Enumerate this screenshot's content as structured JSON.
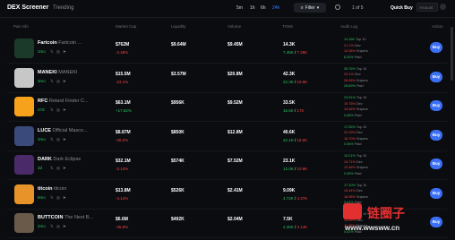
{
  "topbar": {
    "brand": "DEX Screener",
    "trending": "Trending",
    "timeframes": [
      "5m",
      "1h",
      "6h",
      "24h"
    ],
    "filter_label": "Filter",
    "pager": "1 of 5",
    "quick_buy": "Quick Buy",
    "amount_placeholder": "Amount"
  },
  "headers": [
    "Pair Info",
    "Market Cap",
    "Liquidity",
    "Volume",
    "TXNS",
    "Audit Log",
    "Action"
  ],
  "rows": [
    {
      "name": "Fartcoin",
      "full": "Fartcoin ...",
      "age": "2mo",
      "mcap": "$762M",
      "mcap_pct": "-2.48%",
      "mcap_dir": "neg",
      "liq": "$9.64M",
      "vol": "$9.45M",
      "txns": "14.3K",
      "tx_b": "7.45K",
      "tx_s": "7.28K",
      "audit": [
        "14.16K",
        "21.1%",
        "10.08%",
        "8.30%"
      ]
    },
    {
      "name": "MANEKI",
      "full": "MANEKI",
      "age": "3mo",
      "mcap": "$15.5M",
      "mcap_pct": "-23.1%",
      "mcap_dir": "neg",
      "liq": "$3.57M",
      "vol": "$20.8M",
      "txns": "42.3K",
      "tx_b": "22.3K",
      "tx_s": "19.9K",
      "audit": [
        "39.76%",
        "23.1%",
        "26.06%",
        "28.89%"
      ]
    },
    {
      "name": "RFC",
      "full": "Retard Finder C...",
      "age": "27d",
      "mcap": "$63.1M",
      "mcap_pct": "+17.82%",
      "mcap_dir": "pos",
      "liq": "$956K",
      "vol": "$9.52M",
      "txns": "33.5K",
      "tx_b": "16.6K",
      "tx_s": "17K",
      "audit": [
        "23.91%",
        "19.75%",
        "19.46%",
        "0.06%"
      ]
    },
    {
      "name": "LUCE",
      "full": "Official Masco...",
      "age": "2mo",
      "mcap": "$8.87M",
      "mcap_pct": "-28.2%",
      "mcap_dir": "neg",
      "liq": "$850K",
      "vol": "$12.8M",
      "txns": "40.6K",
      "tx_b": "22.1K",
      "tx_s": "18.5K",
      "audit": [
        "17.55%",
        "22.19%",
        "18.70%",
        "0.06%"
      ]
    },
    {
      "name": "DARK",
      "full": "Dark Eclipse",
      "age": "3d",
      "mcap": "$32.1M",
      "mcap_pct": "-3.14%",
      "mcap_dir": "neg",
      "liq": "$574K",
      "vol": "$7.52M",
      "txns": "23.1K",
      "tx_b": "12.0K",
      "tx_s": "10.9K",
      "audit": [
        "10.21%",
        "19.71%",
        "12.46%",
        "0.05%"
      ]
    },
    {
      "name": "titcoin",
      "full": "titcoin",
      "age": "8mo",
      "mcap": "$13.8M",
      "mcap_pct": "-4.14%",
      "mcap_dir": "neg",
      "liq": "$526K",
      "vol": "$2.41M",
      "txns": "9.09K",
      "tx_b": "4.72K",
      "tx_s": "4.37K",
      "audit": [
        "17.10%",
        "15.44%",
        "16.98%",
        "0.04%"
      ]
    },
    {
      "name": "BUTTCOIN",
      "full": "The Next B...",
      "age": "2mo",
      "mcap": "$6.6M",
      "mcap_pct": "-35.8%",
      "mcap_dir": "neg",
      "liq": "$492K",
      "vol": "$2.04M",
      "txns": "7.5K",
      "tx_b": "4.36K",
      "tx_s": "3.14K",
      "audit": [
        "30.81%",
        "13.05%",
        "11.76%",
        "0.02%"
      ]
    }
  ],
  "audit_labels": [
    "Top 10",
    "Dev",
    "Snipers",
    "Paid"
  ],
  "buy_label": "Buy",
  "watermark": {
    "text": "链圈子",
    "url": "www.wwsww.cn"
  },
  "colors": {
    "accent": "#3b6ff5",
    "pos": "#22c55e",
    "neg": "#ef4444"
  }
}
